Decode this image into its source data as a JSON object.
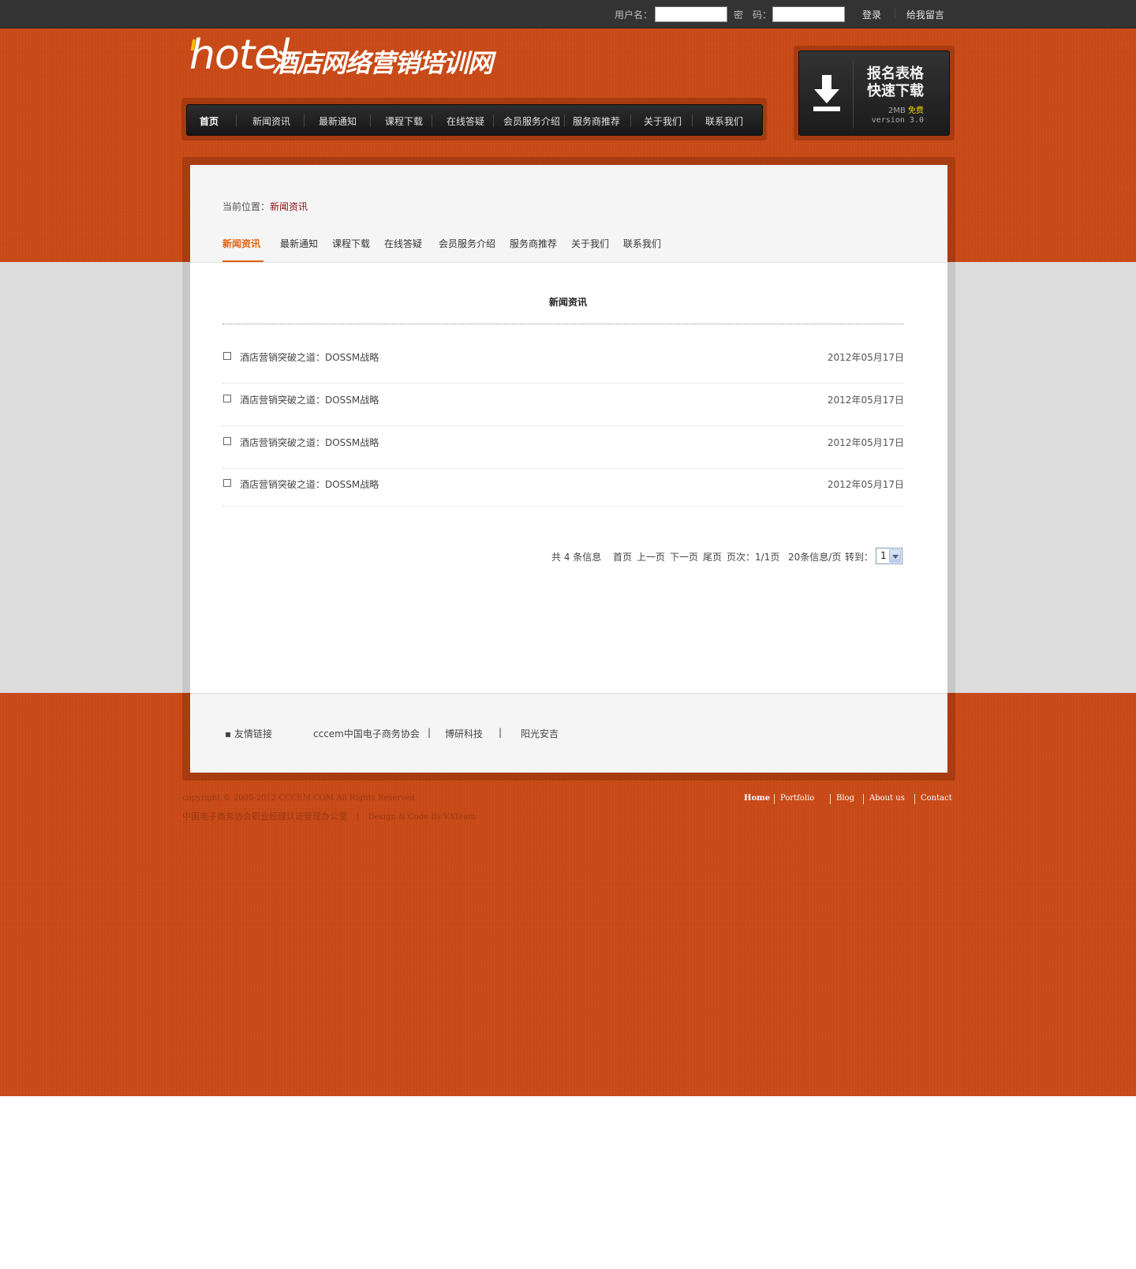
{
  "topbar": {
    "username_label": "用户名：",
    "password_label": "密　码：",
    "login_label": "登录",
    "message_label": "给我留言"
  },
  "logo": {
    "hotel": "hotel",
    "title": "酒店网络营销培训网"
  },
  "main_nav": {
    "items": [
      {
        "label": "首页",
        "active": true
      },
      {
        "label": "新闻资讯"
      },
      {
        "label": "最新通知"
      },
      {
        "label": "课程下载"
      },
      {
        "label": "在线答疑"
      },
      {
        "label": "会员服务介绍"
      },
      {
        "label": "服务商推荐"
      },
      {
        "label": "关于我们"
      },
      {
        "label": "联系我们"
      }
    ]
  },
  "download": {
    "line1": "报名表格",
    "line2": "快速下载",
    "size": "2MB",
    "free": "免费",
    "version": "version 3.0",
    "icon": "download-arrow-icon"
  },
  "breadcrumb": {
    "prefix": "当前位置：",
    "current": "新闻资讯"
  },
  "sub_nav": {
    "items": [
      {
        "label": "新闻资讯",
        "active": true
      },
      {
        "label": "最新通知"
      },
      {
        "label": "课程下载"
      },
      {
        "label": "在线答疑"
      },
      {
        "label": "会员服务介绍"
      },
      {
        "label": "服务商推荐"
      },
      {
        "label": "关于我们"
      },
      {
        "label": "联系我们"
      }
    ]
  },
  "list": {
    "title": "新闻资讯",
    "items": [
      {
        "title": "酒店营销突破之道：DOSSM战略",
        "date": "2012年05月17日"
      },
      {
        "title": "酒店营销突破之道：DOSSM战略",
        "date": "2012年05月17日"
      },
      {
        "title": "酒店营销突破之道：DOSSM战略",
        "date": "2012年05月17日"
      },
      {
        "title": "酒店营销突破之道：DOSSM战略",
        "date": "2012年05月17日"
      }
    ]
  },
  "pager": {
    "total": "共 4 条信息",
    "first": "首页",
    "prev": "上一页",
    "next": "下一页",
    "last": "尾页",
    "pages": "页次：1/1页",
    "per_page": "20条信息/页",
    "goto": "转到：",
    "selected": "1"
  },
  "friend_links": {
    "label": "▪ 友情链接",
    "items": [
      "cccem中国电子商务协会",
      "博研科技",
      "阳光安吉"
    ],
    "separator": "|"
  },
  "footer": {
    "copyright": "copyright © 2005-2012 CCCEM.COM All Rights Reserved",
    "org": "中国电子商务协会职业经理认证管理办公室",
    "sep": "|",
    "design": "Design & Code By VATeam",
    "nav": [
      "Home",
      "Portfolio",
      "Blog",
      "About us",
      "Contact"
    ]
  },
  "colors": {
    "orange_bg": "#c94a17",
    "accent": "#e0620f",
    "crumb_red": "#8c0e0e",
    "topbar": "#333333"
  }
}
